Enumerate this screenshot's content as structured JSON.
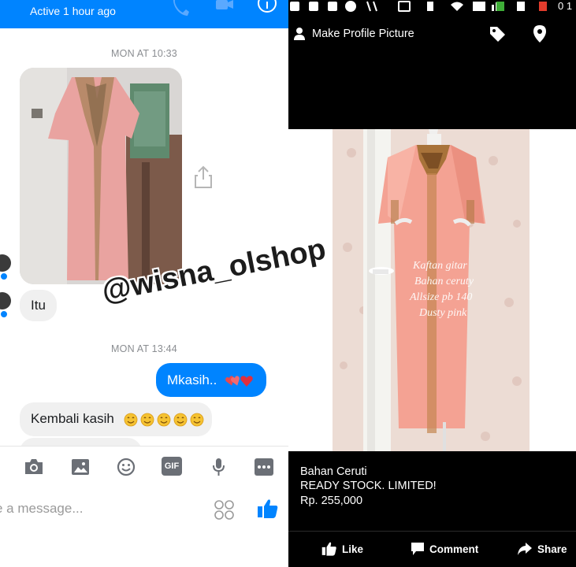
{
  "messenger": {
    "header": {
      "status": "Active 1 hour ago",
      "icons": [
        "phone-icon",
        "video-camera-icon",
        "info-icon"
      ]
    },
    "timestamps": {
      "first": "MON AT 10:33",
      "second": "MON AT 13:44"
    },
    "messages": {
      "itu": "Itu",
      "mkasih": "Mkasih..",
      "kembali": "Kembali kasih"
    },
    "composer": {
      "placeholder": "e a message..."
    },
    "toolbar_icons": [
      "camera-icon",
      "gallery-icon",
      "emoji-icon",
      "gif-icon",
      "microphone-icon",
      "more-icon"
    ],
    "gif_label": "GIF"
  },
  "watermark": "@wisna_olshop",
  "photo_viewer": {
    "title": "Make Profile Picture",
    "status_bar": {
      "time": "0 1"
    },
    "overlay_text": [
      "Kaftan gitar",
      "Bahan ceruty",
      "Allsize pb 140",
      "Dusty pink"
    ],
    "caption": [
      "Bahan Ceruti",
      "READY STOCK.  LIMITED!",
      "Rp. 255,000"
    ],
    "actions": {
      "like": "Like",
      "comment": "Comment",
      "share": "Share"
    }
  },
  "colors": {
    "messenger_blue": "#0084ff",
    "bubble_gray": "#f0f0f0",
    "dress_pink": "#f29a8b"
  }
}
